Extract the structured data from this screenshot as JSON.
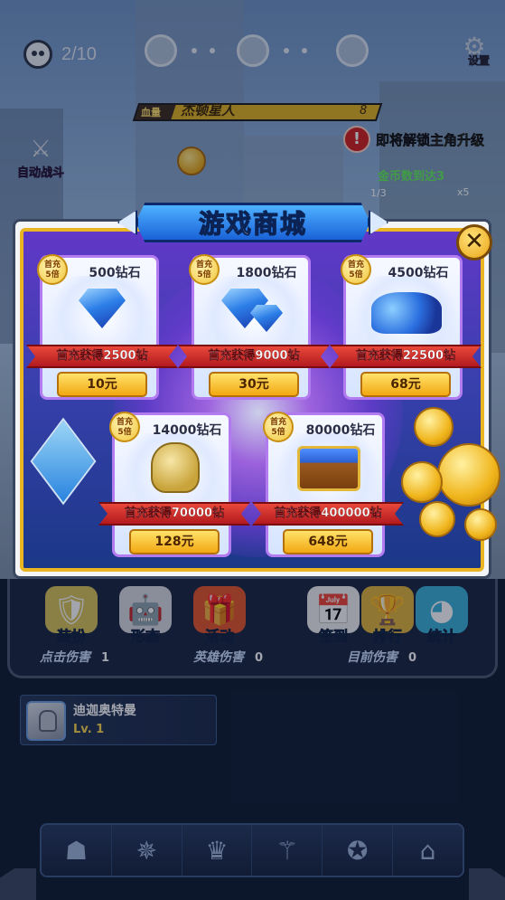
{
  "hud": {
    "stage_progress": "2/10",
    "settings_label": "设置",
    "boss_hp_label": "血量",
    "boss_name": "杰顿星人",
    "boss_count": "8",
    "unlock_prefix": "即将解锁",
    "unlock_highlight": "主角升级",
    "gold_task": "金币数到达3",
    "task_progress": "1/3",
    "task_reward": "x5",
    "auto_battle_label": "自动战斗"
  },
  "shop": {
    "title": "游戏商城",
    "close_icon": "close-icon",
    "badge_line1": "首充",
    "badge_line2": "5倍",
    "items": [
      {
        "title": "500钻石",
        "bonus": "首充获得2500钻",
        "price": "10元"
      },
      {
        "title": "1800钻石",
        "bonus": "首充获得9000钻",
        "price": "30元"
      },
      {
        "title": "4500钻石",
        "bonus": "首充获得22500钻",
        "price": "68元"
      },
      {
        "title": "14000钻石",
        "bonus": "首充获得70000钻",
        "price": "128元"
      },
      {
        "title": "80000钻石",
        "bonus": "首充获得400000钻",
        "price": "648元"
      }
    ]
  },
  "features": [
    {
      "label": "装扮",
      "icon": "armor-icon"
    },
    {
      "label": "形态",
      "icon": "form-icon"
    },
    {
      "label": "活动",
      "icon": "gift-icon"
    },
    {
      "label": "签到",
      "icon": "calendar-icon"
    },
    {
      "label": "排行",
      "icon": "trophy-icon"
    },
    {
      "label": "统计",
      "icon": "pie-chart-icon"
    }
  ],
  "stats": [
    {
      "label": "点击伤害",
      "value": "1"
    },
    {
      "label": "英雄伤害",
      "value": "0"
    },
    {
      "label": "目前伤害",
      "value": "0"
    }
  ],
  "hero": {
    "name": "迪迦奥特曼",
    "level": "Lv. 1"
  },
  "tabs": [
    "hero-helmet-icon",
    "emblem-icon",
    "crown-icon",
    "weapon-icon",
    "medal-icon",
    "shop-icon"
  ],
  "colors": {
    "accent_gold": "#e9b522",
    "ribbon_red": "#c8262a",
    "panel_blue": "#182447",
    "task_green": "#62f05a"
  }
}
